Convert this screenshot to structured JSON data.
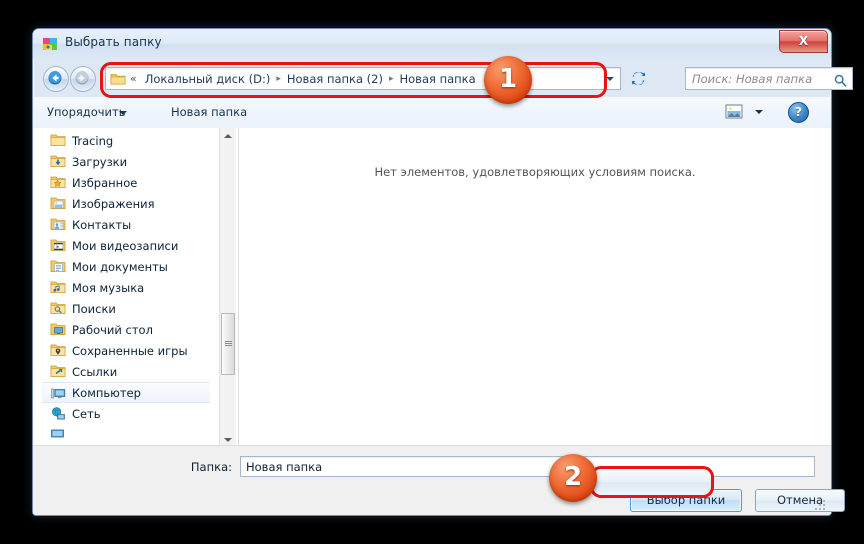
{
  "window": {
    "title": "Выбрать папку",
    "title_icon": "folder-picker-icon",
    "close_label": "X"
  },
  "navigation": {
    "back_icon": "back-arrow-icon",
    "forward_icon": "forward-arrow-icon",
    "refresh_icon": "refresh-icon",
    "address_dropdown_icon": "chevron-down-icon",
    "breadcrumb": {
      "folder_icon": "folder-icon",
      "overflow": "«",
      "separator": "▸",
      "items": [
        {
          "label": "Локальный диск (D:)"
        },
        {
          "label": "Новая папка (2)"
        },
        {
          "label": "Новая папка"
        }
      ]
    },
    "search": {
      "placeholder": "Поиск: Новая папка",
      "icon": "search-icon"
    }
  },
  "toolbar": {
    "organize_label": "Упорядочить",
    "organize_caret_icon": "chevron-down-icon",
    "new_folder_label": "Новая папка",
    "view_icon": "view-mode-icon",
    "view_caret_icon": "chevron-down-icon",
    "help_label": "?",
    "help_icon": "help-icon"
  },
  "nav_pane": {
    "items": [
      {
        "label": "Tracing",
        "icon": "folder-icon",
        "selected": false
      },
      {
        "label": "Загрузки",
        "icon": "downloads-folder-icon",
        "selected": false
      },
      {
        "label": "Избранное",
        "icon": "favorites-folder-icon",
        "selected": false
      },
      {
        "label": "Изображения",
        "icon": "pictures-folder-icon",
        "selected": false
      },
      {
        "label": "Контакты",
        "icon": "contacts-folder-icon",
        "selected": false
      },
      {
        "label": "Мои видеозаписи",
        "icon": "videos-folder-icon",
        "selected": false
      },
      {
        "label": "Мои документы",
        "icon": "documents-folder-icon",
        "selected": false
      },
      {
        "label": "Моя музыка",
        "icon": "music-folder-icon",
        "selected": false
      },
      {
        "label": "Поиски",
        "icon": "searches-folder-icon",
        "selected": false
      },
      {
        "label": "Рабочий стол",
        "icon": "desktop-folder-icon",
        "selected": false
      },
      {
        "label": "Сохраненные игры",
        "icon": "saved-games-folder-icon",
        "selected": false
      },
      {
        "label": "Ссылки",
        "icon": "links-folder-icon",
        "selected": false
      },
      {
        "label": "Компьютер",
        "icon": "computer-icon",
        "selected": true
      },
      {
        "label": "Сеть",
        "icon": "network-icon",
        "selected": false
      }
    ],
    "scrollbar": {
      "up_icon": "scroll-up-arrow-icon",
      "down_icon": "scroll-down-arrow-icon"
    }
  },
  "file_pane": {
    "empty_message": "Нет элементов, удовлетворяющих условиям поиска."
  },
  "bottom": {
    "folder_label": "Папка:",
    "folder_value": "Новая папка",
    "select_button": "Выбор папки",
    "cancel_button": "Отмена"
  },
  "annotations": {
    "badge_one": "1",
    "badge_two": "2",
    "highlight_color": "#e81313",
    "badge_color": "#ef6a34"
  }
}
